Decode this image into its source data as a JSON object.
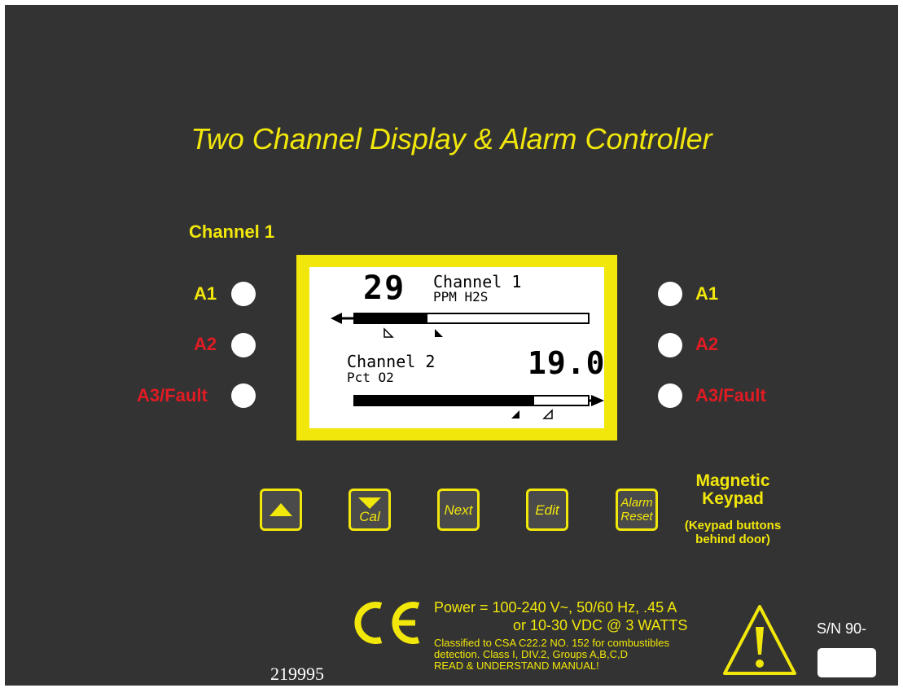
{
  "title": "Two Channel Display & Alarm Controller",
  "channel_label": "Channel 1",
  "alarms": {
    "left": {
      "a1": "A1",
      "a2": "A2",
      "a3": "A3/Fault"
    },
    "right": {
      "a1": "A1",
      "a2": "A2",
      "a3": "A3/Fault"
    }
  },
  "display": {
    "channel1": {
      "value": "29",
      "name": "Channel 1",
      "units": "PPM H2S",
      "bar_fill": 0.31
    },
    "channel2": {
      "name": "Channel 2",
      "units": "Pct O2",
      "value": "19.0",
      "bar_fill": 0.77
    }
  },
  "keypad": {
    "up": "",
    "down_cal": "Cal",
    "next": "Next",
    "edit": "Edit",
    "alarm_reset_line1": "Alarm",
    "alarm_reset_line2": "Reset",
    "title_line1": "Magnetic",
    "title_line2": "Keypad",
    "note_line1": "(Keypad buttons",
    "note_line2": "behind door)"
  },
  "footer": {
    "ce_mark": "CE",
    "power_line1": "Power = 100-240 V~, 50/60 Hz, .45 A",
    "power_line2": "or 10-30 VDC @ 3 WATTS",
    "class_line1": "Classified to CSA C22.2 NO. 152 for combustibles",
    "class_line2": "detection. Class I, DIV.2, Groups A,B,C,D",
    "class_line3": "READ & UNDERSTAND MANUAL!",
    "serial": "S/N 90-",
    "part_number": "219995"
  },
  "colors": {
    "accent": "#f2e70a",
    "alarm_red": "#e01b24",
    "panel": "#333333"
  }
}
